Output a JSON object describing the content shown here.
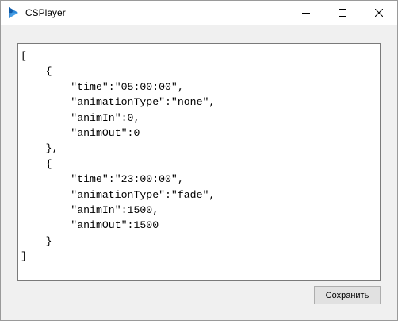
{
  "window": {
    "title": "CSPlayer",
    "icon": "csplayer-play-icon",
    "controls": {
      "minimize": "minimize-icon",
      "maximize": "maximize-icon",
      "close": "close-icon"
    }
  },
  "editor": {
    "content": "[\n    {\n        \"time\":\"05:00:00\",\n        \"animationType\":\"none\",\n        \"animIn\":0,\n        \"animOut\":0\n    },\n    {\n        \"time\":\"23:00:00\",\n        \"animationType\":\"fade\",\n        \"animIn\":1500,\n        \"animOut\":1500\n    }\n]"
  },
  "footer": {
    "save_label": "Сохранить"
  },
  "colors": {
    "icon_blue": "#2b88d8",
    "icon_dark_blue": "#0f5aa8",
    "window_bg": "#f0f0f0",
    "titlebar_bg": "#ffffff"
  }
}
